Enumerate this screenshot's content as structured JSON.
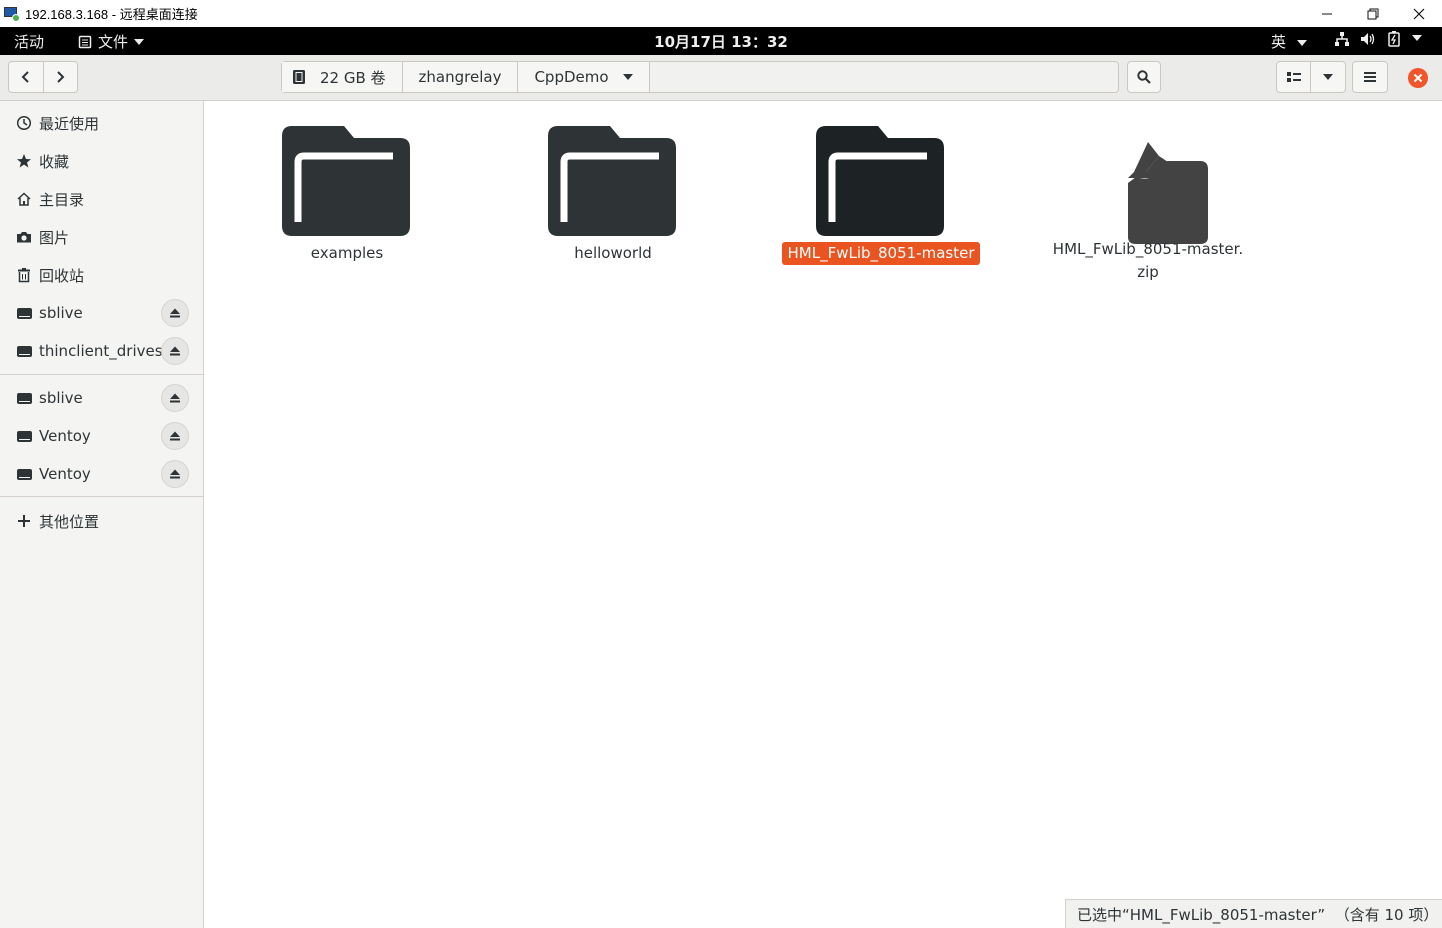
{
  "window": {
    "title": "192.168.3.168 - 远程桌面连接",
    "controls": [
      "minimize",
      "restore",
      "close"
    ]
  },
  "topbar": {
    "activities": "活动",
    "app_menu": "文件",
    "clock": "10月17日 13：32",
    "input_method": "英"
  },
  "headerbar": {
    "path": [
      {
        "label": "22 GB 卷",
        "icon": "drive-icon"
      },
      {
        "label": "zhangrelay"
      },
      {
        "label": "CppDemo"
      }
    ]
  },
  "sidebar": {
    "places": [
      {
        "label": "最近使用",
        "icon": "clock-icon"
      },
      {
        "label": "收藏",
        "icon": "star-icon"
      },
      {
        "label": "主目录",
        "icon": "home-icon"
      },
      {
        "label": "图片",
        "icon": "camera-icon"
      },
      {
        "label": "回收站",
        "icon": "trash-icon"
      }
    ],
    "mounted": [
      {
        "label": "sblive",
        "icon": "drive-icon"
      },
      {
        "label": "thinclient_drives",
        "icon": "drive-icon"
      }
    ],
    "devices": [
      {
        "label": "sblive",
        "icon": "drive-icon"
      },
      {
        "label": "Ventoy",
        "icon": "drive-icon"
      },
      {
        "label": "Ventoy",
        "icon": "drive-icon"
      }
    ],
    "other": {
      "label": "其他位置",
      "icon": "plus-icon"
    }
  },
  "files": [
    {
      "name": "examples",
      "type": "folder",
      "selected": false
    },
    {
      "name": "helloworld",
      "type": "folder",
      "selected": false
    },
    {
      "name": "HML_FwLib_8051-master",
      "type": "folder",
      "selected": true
    },
    {
      "name_line1": "HML_FwLib_8051-master.",
      "name_line2": "zip",
      "type": "archive",
      "selected": false
    }
  ],
  "status": {
    "text": "已选中“HML_FwLib_8051-master”  （含有 10 项）"
  },
  "colors": {
    "accent": "#e95420",
    "close": "#f0552b",
    "folder": "#2e3436",
    "topbar": "#000000"
  }
}
